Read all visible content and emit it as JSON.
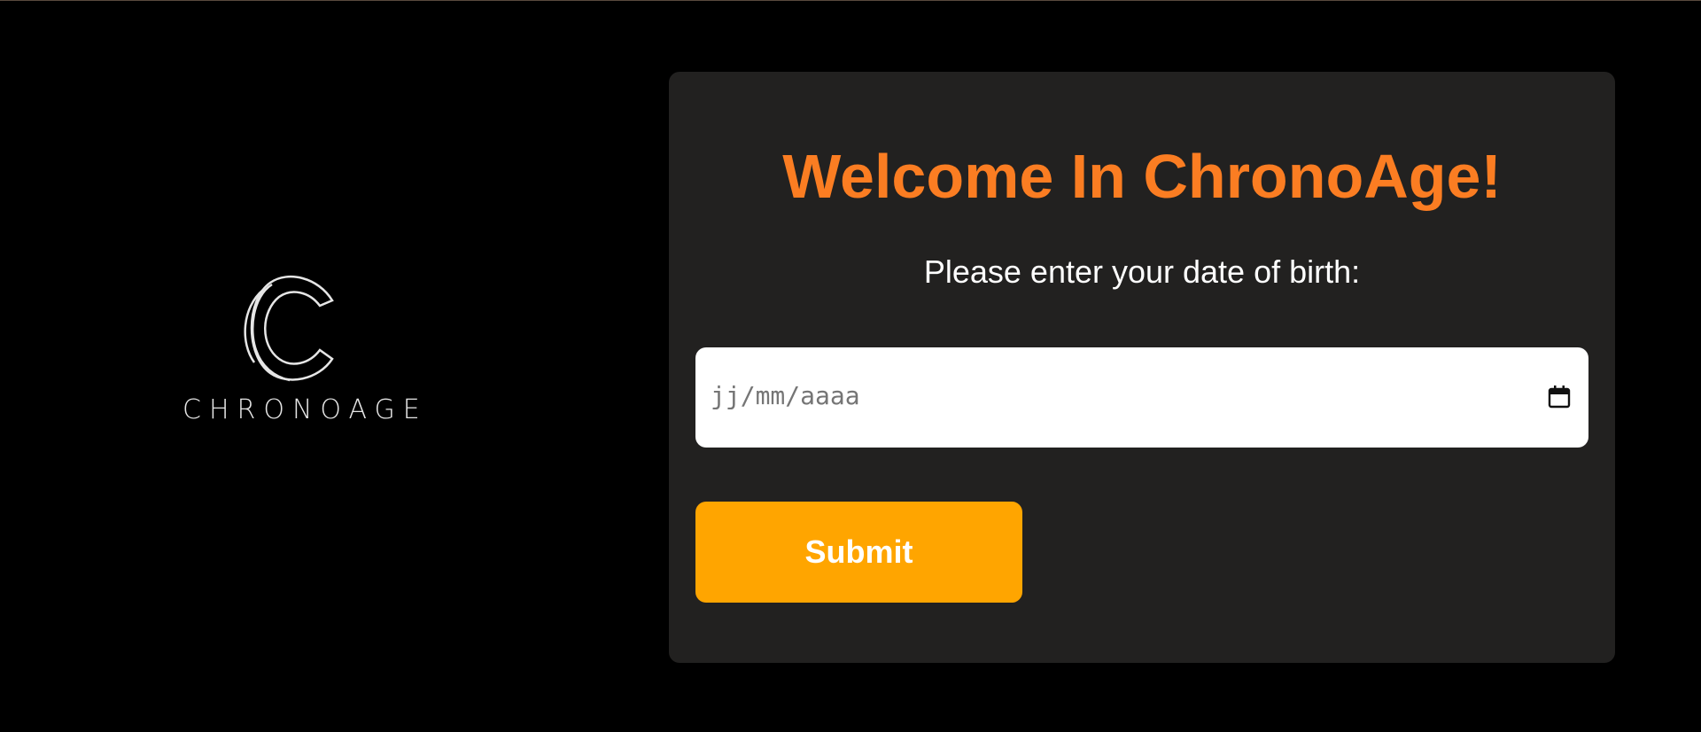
{
  "logo": {
    "text": "CHRONOAGE",
    "icon": "chronoage-c-logo",
    "color": "#e6e6e6"
  },
  "card": {
    "title": "Welcome In ChronoAge!",
    "subtitle": "Please enter your date of birth:",
    "date_input": {
      "placeholder": "jj/mm/aaaa",
      "value": "",
      "icon": "calendar-icon"
    },
    "submit_label": "Submit"
  },
  "colors": {
    "background": "#000000",
    "card_background": "#222120",
    "title": "#fb7d22",
    "button": "#ffa500",
    "text": "#ffffff"
  }
}
